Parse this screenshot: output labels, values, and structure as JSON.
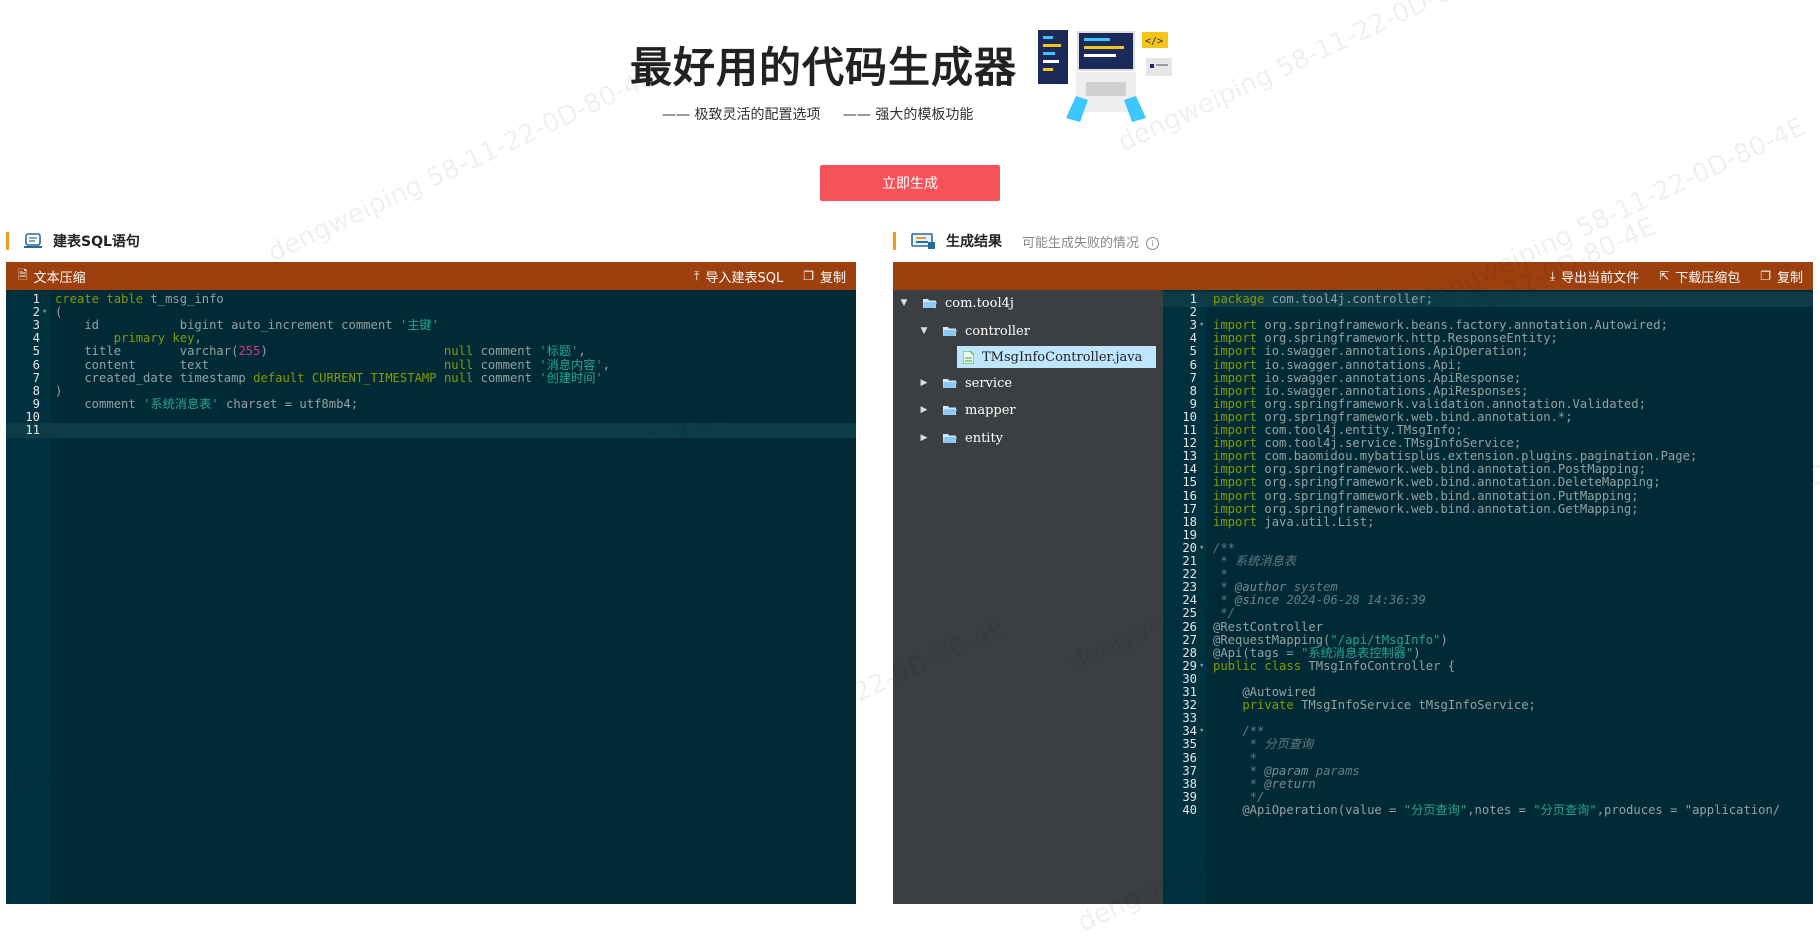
{
  "hero": {
    "title": "最好用的代码生成器",
    "features": [
      "—— 极致灵活的配置选项",
      "—— 强大的模板功能"
    ]
  },
  "generate_button": "立即生成",
  "left_section": {
    "title": "建表SQL语句"
  },
  "right_section": {
    "title": "生成结果",
    "hint": "可能生成失败的情况"
  },
  "left_toolbar": {
    "compress": "文本压缩",
    "import": "导入建表SQL",
    "copy": "复制"
  },
  "right_toolbar": {
    "export": "导出当前文件",
    "download": "下载压缩包",
    "copy": "复制"
  },
  "tree": {
    "root": "com.tool4j",
    "controller": "controller",
    "selected_file": "TMsgInfoController.java",
    "service": "service",
    "mapper": "mapper",
    "entity": "entity"
  },
  "sql_lines": [
    "create table t_msg_info",
    "(",
    "    id           bigint auto_increment comment '主键'",
    "        primary key,",
    "    title        varchar(255)                        null comment '标题',",
    "    content      text                                null comment '消息内容',",
    "    created_date timestamp default CURRENT_TIMESTAMP null comment '创建时间'",
    ")",
    "    comment '系统消息表' charset = utf8mb4;",
    "",
    ""
  ],
  "java_lines": [
    "package com.tool4j.controller;",
    "",
    "import org.springframework.beans.factory.annotation.Autowired;",
    "import org.springframework.http.ResponseEntity;",
    "import io.swagger.annotations.ApiOperation;",
    "import io.swagger.annotations.Api;",
    "import io.swagger.annotations.ApiResponse;",
    "import io.swagger.annotations.ApiResponses;",
    "import org.springframework.validation.annotation.Validated;",
    "import org.springframework.web.bind.annotation.*;",
    "import com.tool4j.entity.TMsgInfo;",
    "import com.tool4j.service.TMsgInfoService;",
    "import com.baomidou.mybatisplus.extension.plugins.pagination.Page;",
    "import org.springframework.web.bind.annotation.PostMapping;",
    "import org.springframework.web.bind.annotation.DeleteMapping;",
    "import org.springframework.web.bind.annotation.PutMapping;",
    "import org.springframework.web.bind.annotation.GetMapping;",
    "import java.util.List;",
    "",
    "/**",
    " * 系统消息表",
    " *",
    " * @author system",
    " * @since 2024-06-28 14:36:39",
    " */",
    "@RestController",
    "@RequestMapping(\"/api/tMsgInfo\")",
    "@Api(tags = \"系统消息表控制器\")",
    "public class TMsgInfoController {",
    "",
    "    @Autowired",
    "    private TMsgInfoService tMsgInfoService;",
    "",
    "    /**",
    "     * 分页查询",
    "     *",
    "     * @param params",
    "     * @return",
    "     */",
    "    @ApiOperation(value = \"分页查询\",notes = \"分页查询\",produces = \"application/"
  ],
  "watermark": "dengweiping  58-11-22-0D-80-4E"
}
